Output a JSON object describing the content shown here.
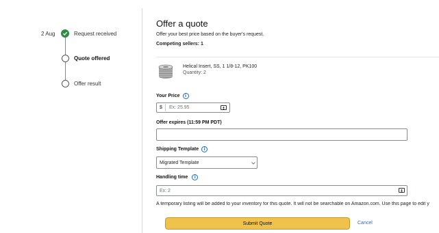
{
  "timeline": {
    "date": "2 Aug",
    "steps": [
      {
        "label": "Request received",
        "state": "done"
      },
      {
        "label": "Quote offered",
        "state": "current"
      },
      {
        "label": "Offer result",
        "state": "pending"
      }
    ]
  },
  "header": {
    "title": "Offer a quote",
    "subtitle": "Offer your best price based on the buyer's request.",
    "competing": "Competing sellers: 1"
  },
  "product": {
    "name": "Helical Insert, SS, 1 1/8-12, PK100",
    "quantity": "Quantity: 2",
    "image_icon": "helical-insert-image"
  },
  "price": {
    "label": "Your Price",
    "currency": "$",
    "placeholder": "Ex: 25.95"
  },
  "expires": {
    "label": "Offer expires (11:59 PM PDT)",
    "value": ""
  },
  "shipping": {
    "label": "Shipping Template",
    "selected": "Migrated Template"
  },
  "handling": {
    "label": "Handling time",
    "placeholder": "Ex: 2"
  },
  "notice": "A temporary listing will be added to your inventory for this quote. It will not be searchable on Amazon.com. Use this page to edit y",
  "actions": {
    "submit": "Submit Quote",
    "cancel": "Cancel"
  },
  "colors": {
    "done": "#2f8d46",
    "accent_button": "#f0c14b",
    "link": "#1b6ac9"
  }
}
